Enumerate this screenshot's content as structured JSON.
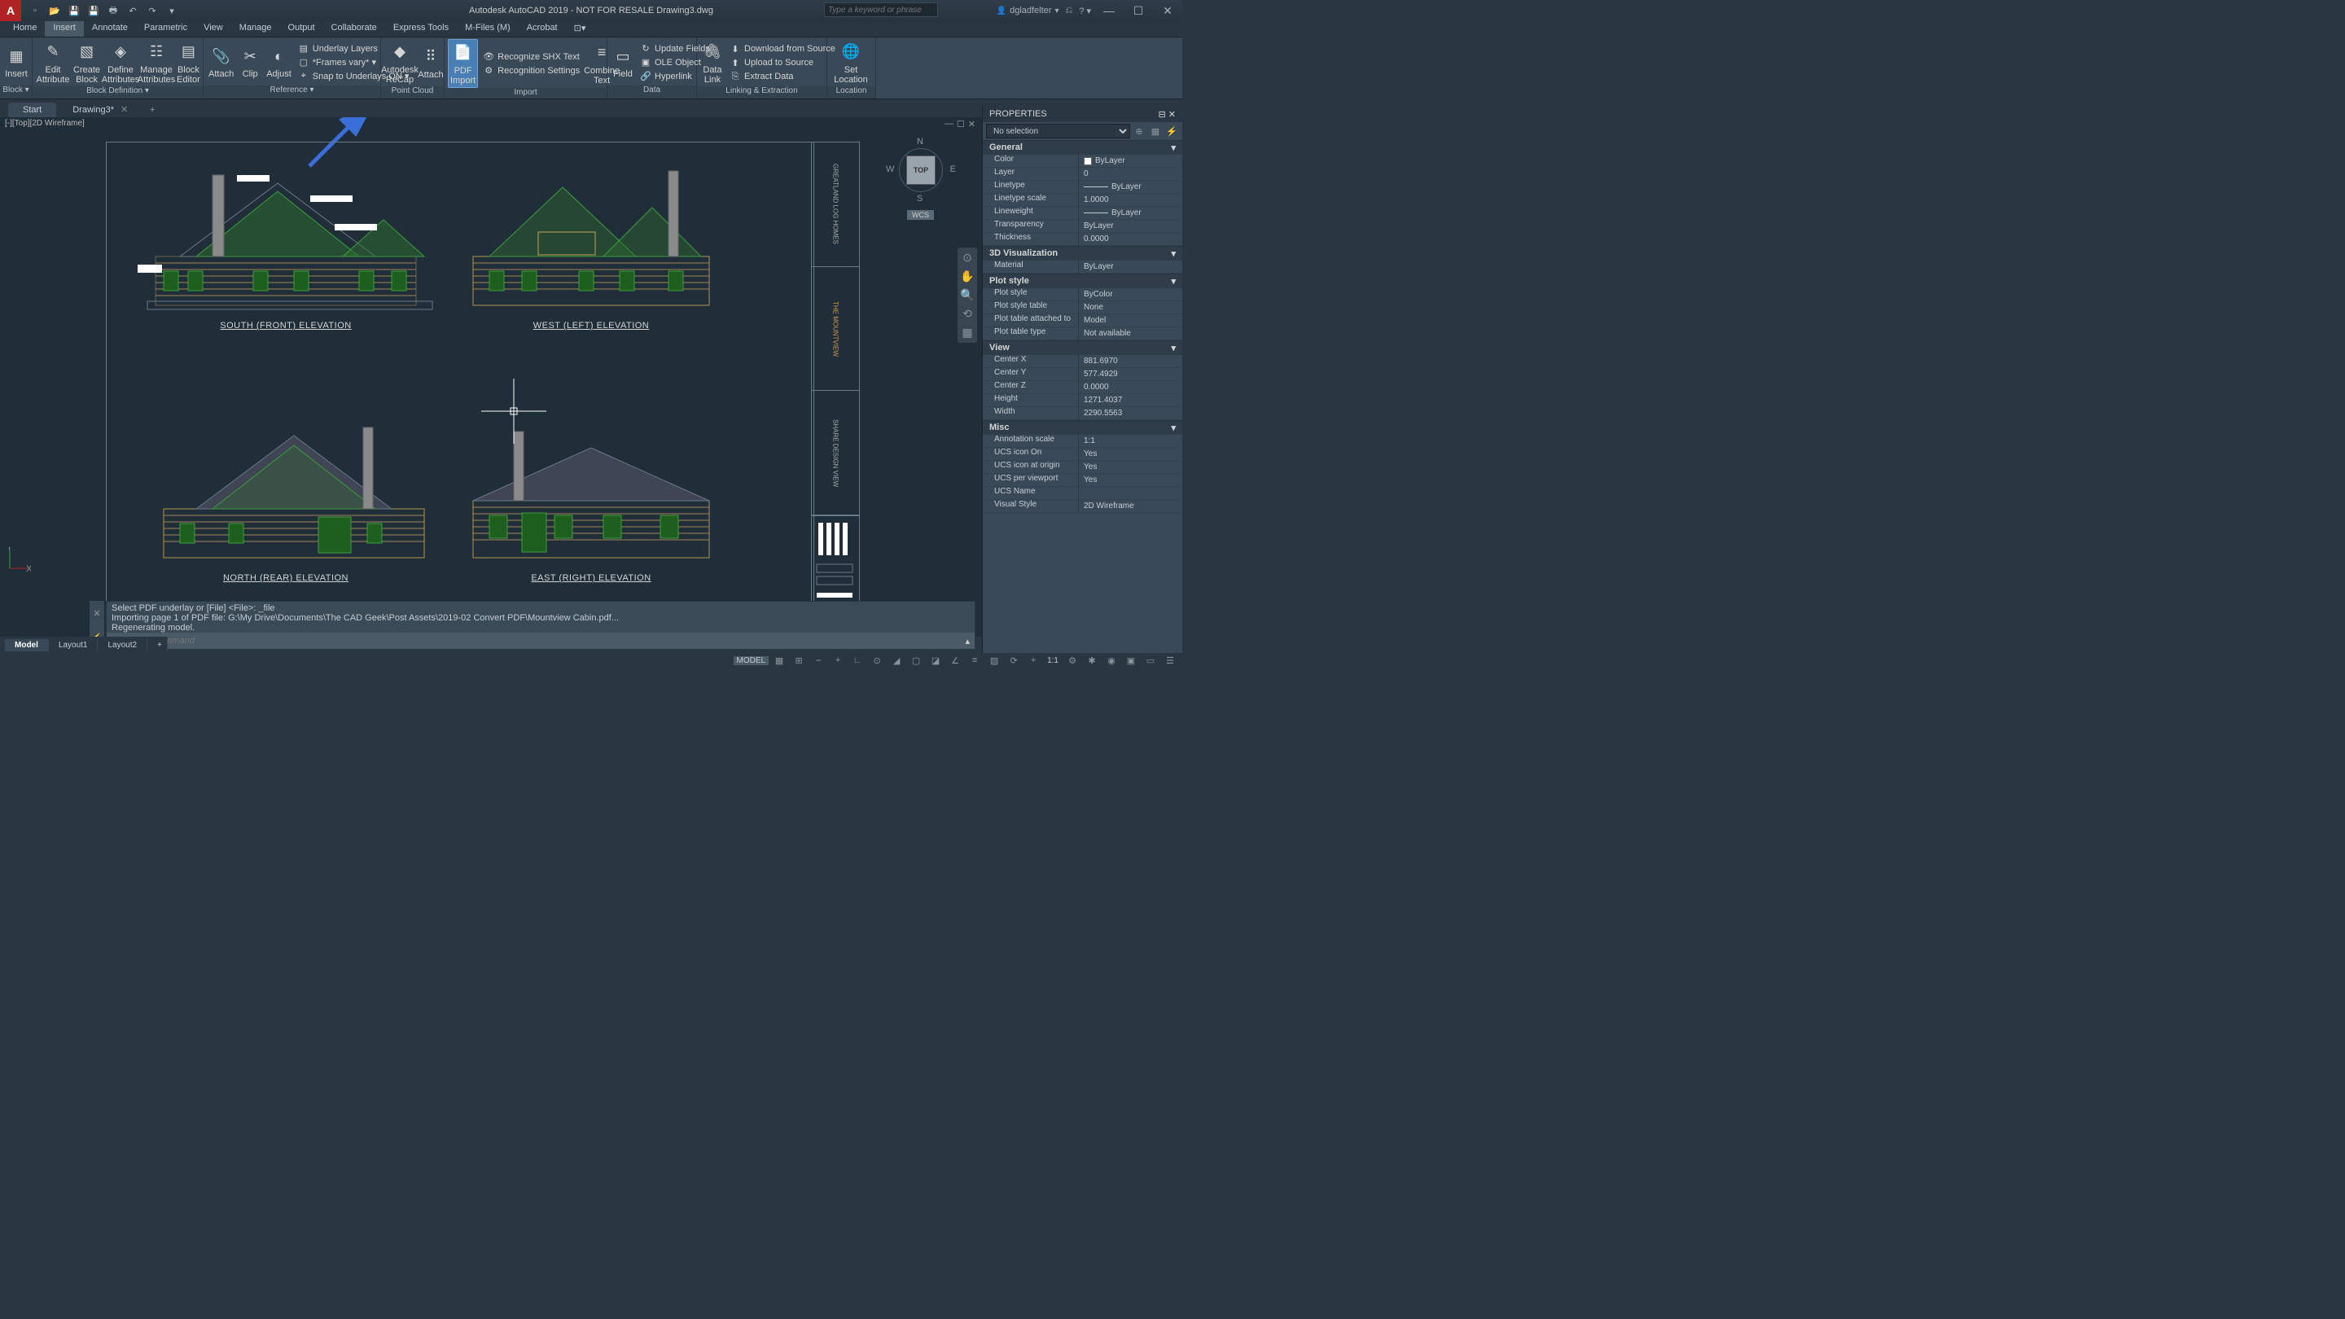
{
  "title": "Autodesk AutoCAD 2019 - NOT FOR RESALE    Drawing3.dwg",
  "search_placeholder": "Type a keyword or phrase",
  "username": "dgladfelter",
  "menus": [
    "Home",
    "Insert",
    "Annotate",
    "Parametric",
    "View",
    "Manage",
    "Output",
    "Collaborate",
    "Express Tools",
    "M-Files (M)",
    "Acrobat"
  ],
  "ribbon": {
    "block": {
      "insert": "Insert",
      "edit_attr": "Edit Attribute",
      "create": "Create Block",
      "define": "Define Attributes",
      "manage": "Manage Attributes",
      "editor": "Block Editor",
      "title": "Block ▾"
    },
    "blockdef_title": "Block Definition ▾",
    "ref": {
      "attach": "Attach",
      "clip": "Clip",
      "adjust": "Adjust",
      "ulayers": "Underlay Layers",
      "frames": "*Frames vary* ▾",
      "snap": "Snap to Underlays ON ▾",
      "title": "Reference ▾"
    },
    "pointcloud": {
      "recap": "Autodesk ReCap",
      "attach": "Attach",
      "title": "Point Cloud"
    },
    "import": {
      "pdf": "PDF Import",
      "shx": "Recognize SHX Text",
      "rset": "Recognition Settings",
      "combine": "Combine Text",
      "title": "Import"
    },
    "data": {
      "field": "Field",
      "upd": "Update Fields",
      "ole": "OLE Object",
      "hyper": "Hyperlink",
      "title": "Data"
    },
    "linking": {
      "datalink": "Data Link",
      "download": "Download from Source",
      "upload": "Upload to Source",
      "extract": "Extract Data",
      "title": "Linking & Extraction"
    },
    "location": {
      "set": "Set Location",
      "title": "Location"
    }
  },
  "filetabs": {
    "start": "Start",
    "active": "Drawing3*"
  },
  "viewport_label": "[-][Top][2D Wireframe]",
  "viewcube": {
    "top": "TOP",
    "wcs": "WCS",
    "n": "N",
    "s": "S",
    "e": "E",
    "w": "W"
  },
  "elevations": {
    "south": "SOUTH (FRONT) ELEVATION",
    "west": "WEST (LEFT) ELEVATION",
    "north": "NORTH (REAR) ELEVATION",
    "east": "EAST (RIGHT) ELEVATION"
  },
  "titleblock": {
    "company": "GREATLAND LOG HOMES",
    "project": "THE MOUNTVIEW",
    "sheet": "SHARE DESIGN VIEW"
  },
  "cmd": {
    "l1": "Select PDF underlay or [File] <File>: _file",
    "l2": "Importing page 1 of PDF file: G:\\My Drive\\Documents\\The CAD Geek\\Post Assets\\2019-02 Convert PDF\\Mountview Cabin.pdf...",
    "l3": "Regenerating model.",
    "placeholder": "Type a command"
  },
  "layouts": [
    "Model",
    "Layout1",
    "Layout2"
  ],
  "status": {
    "model": "MODEL",
    "scale": "1:1"
  },
  "properties": {
    "title": "PROPERTIES",
    "selection": "No selection",
    "cats": {
      "general": "General",
      "viz": "3D Visualization",
      "plot": "Plot style",
      "view": "View",
      "misc": "Misc"
    },
    "general": [
      [
        "Color",
        "ByLayer"
      ],
      [
        "Layer",
        "0"
      ],
      [
        "Linetype",
        "ByLayer"
      ],
      [
        "Linetype scale",
        "1.0000"
      ],
      [
        "Lineweight",
        "ByLayer"
      ],
      [
        "Transparency",
        "ByLayer"
      ],
      [
        "Thickness",
        "0.0000"
      ]
    ],
    "viz": [
      [
        "Material",
        "ByLayer"
      ]
    ],
    "plot": [
      [
        "Plot style",
        "ByColor"
      ],
      [
        "Plot style table",
        "None"
      ],
      [
        "Plot table attached to",
        "Model"
      ],
      [
        "Plot table type",
        "Not available"
      ]
    ],
    "view": [
      [
        "Center X",
        "881.6970"
      ],
      [
        "Center Y",
        "577.4929"
      ],
      [
        "Center Z",
        "0.0000"
      ],
      [
        "Height",
        "1271.4037"
      ],
      [
        "Width",
        "2290.5563"
      ]
    ],
    "misc": [
      [
        "Annotation scale",
        "1:1"
      ],
      [
        "UCS icon On",
        "Yes"
      ],
      [
        "UCS icon at origin",
        "Yes"
      ],
      [
        "UCS per viewport",
        "Yes"
      ],
      [
        "UCS Name",
        ""
      ],
      [
        "Visual Style",
        "2D Wireframe"
      ]
    ]
  }
}
